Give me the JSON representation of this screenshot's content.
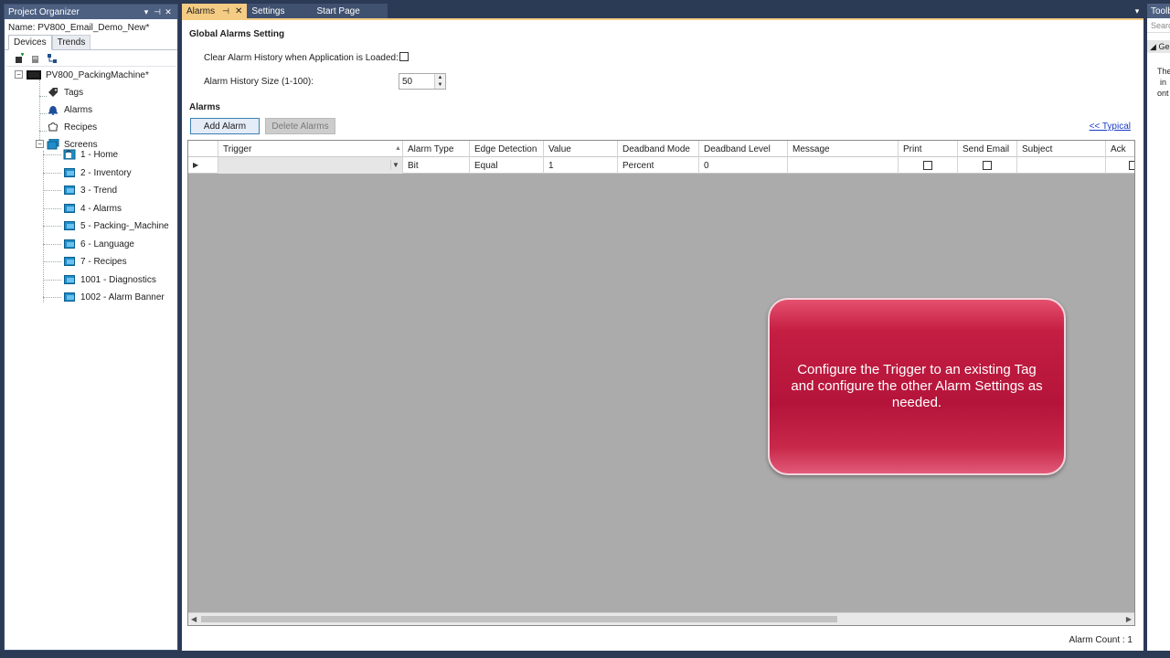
{
  "project_organizer": {
    "title": "Project Organizer",
    "header_controls": [
      "▾",
      "⊣",
      "✕"
    ],
    "name_label": "Name:",
    "name_value": "PV800_Email_Demo_New*",
    "tabs": [
      {
        "label": "Devices",
        "active": true
      },
      {
        "label": "Trends",
        "active": false
      }
    ],
    "tree": {
      "root": "PV800_PackingMachine*",
      "items": [
        {
          "label": "Tags",
          "icon": "tag-icon"
        },
        {
          "label": "Alarms",
          "icon": "bell-icon"
        },
        {
          "label": "Recipes",
          "icon": "chef-hat-icon"
        },
        {
          "label": "Screens",
          "icon": "screens-icon"
        }
      ],
      "screens": [
        "1 - Home",
        "2 - Inventory",
        "3 - Trend",
        "4 - Alarms",
        "5 - Packing-_Machine",
        "6 - Language",
        "7 - Recipes",
        "1001 - Diagnostics",
        "1002 - Alarm Banner"
      ]
    }
  },
  "document_tabs": [
    {
      "label": "Alarms",
      "active": true
    },
    {
      "label": "Settings",
      "active": false
    },
    {
      "label": "Start Page",
      "active": false
    }
  ],
  "global_settings": {
    "title": "Global Alarms Setting",
    "clear_history_label": "Clear Alarm History when Application is Loaded:",
    "clear_history_checked": false,
    "history_size_label": "Alarm History Size (1-100):",
    "history_size_value": "50"
  },
  "alarms_section": {
    "title": "Alarms",
    "add_button": "Add Alarm",
    "delete_button": "Delete Alarms",
    "typical_link": "<< Typical"
  },
  "grid": {
    "columns": [
      "Trigger",
      "Alarm Type",
      "Edge Detection",
      "Value",
      "Deadband Mode",
      "Deadband Level",
      "Message",
      "Print",
      "Send Email",
      "Subject",
      "Ack"
    ],
    "rows": [
      {
        "trigger": "",
        "alarm_type": "Bit",
        "edge_detection": "Equal",
        "value": "1",
        "deadband_mode": "Percent",
        "deadband_level": "0",
        "message": "",
        "print": false,
        "send_email": false,
        "subject": "",
        "ack": false
      }
    ]
  },
  "callout": {
    "text": "Configure the Trigger to an existing Tag and configure the other Alarm Settings as needed."
  },
  "status": {
    "alarm_count": "Alarm Count : 1"
  },
  "toolbox": {
    "title": "Toolbox",
    "search_placeholder": "Search",
    "group": "General",
    "text": [
      "The",
      "in",
      "ont"
    ]
  },
  "colors": {
    "title_bar": "#4d6082",
    "active_tab": "#f5cc84",
    "callout": "#b5143a",
    "grid_bg": "#ababab",
    "frame": "#2b3a55"
  }
}
